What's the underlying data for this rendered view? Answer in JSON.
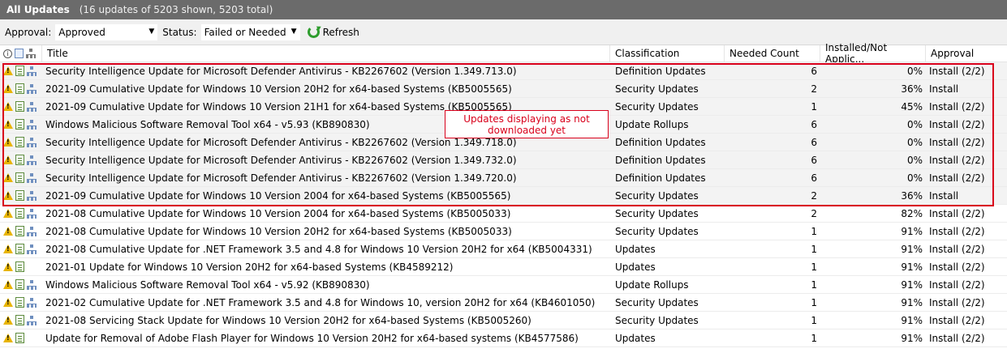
{
  "titlebar": {
    "title": "All Updates",
    "subtitle": "(16 updates of 5203 shown, 5203 total)"
  },
  "toolbar": {
    "approval_label": "Approval:",
    "approval_value": "Approved",
    "status_label": "Status:",
    "status_value": "Failed or Needed",
    "refresh_label": "Refresh"
  },
  "columns": {
    "title": "Title",
    "classification": "Classification",
    "needed": "Needed Count",
    "installed": "Installed/Not Applic...",
    "approval": "Approval"
  },
  "annotation": {
    "text": "Updates displaying as not downloaded yet",
    "color": "#d9001b"
  },
  "rows": [
    {
      "title": "Security Intelligence Update for Microsoft Defender Antivirus - KB2267602 (Version 1.349.713.0)",
      "classification": "Definition Updates",
      "needed": "6",
      "installed": "0%",
      "approval": "Install (2/2)",
      "icons": [
        "warning-icon",
        "update-doc-icon",
        "hierarchy-icon"
      ]
    },
    {
      "title": "2021-09 Cumulative Update for Windows 10 Version 20H2 for x64-based Systems (KB5005565)",
      "classification": "Security Updates",
      "needed": "2",
      "installed": "36%",
      "approval": "Install",
      "icons": [
        "warning-icon",
        "update-doc-icon",
        "hierarchy-icon"
      ]
    },
    {
      "title": "2021-09 Cumulative Update for Windows 10 Version 21H1 for x64-based Systems (KB5005565)",
      "classification": "Security Updates",
      "needed": "1",
      "installed": "45%",
      "approval": "Install (2/2)",
      "icons": [
        "warning-icon",
        "update-doc-icon",
        "hierarchy-icon"
      ]
    },
    {
      "title": "Windows Malicious Software Removal Tool x64 - v5.93 (KB890830)",
      "classification": "Update Rollups",
      "needed": "6",
      "installed": "0%",
      "approval": "Install (2/2)",
      "icons": [
        "warning-icon",
        "update-doc-icon",
        "hierarchy-icon"
      ]
    },
    {
      "title": "Security Intelligence Update for Microsoft Defender Antivirus - KB2267602 (Version 1.349.718.0)",
      "classification": "Definition Updates",
      "needed": "6",
      "installed": "0%",
      "approval": "Install (2/2)",
      "icons": [
        "warning-icon",
        "update-doc-icon",
        "hierarchy-icon"
      ]
    },
    {
      "title": "Security Intelligence Update for Microsoft Defender Antivirus - KB2267602 (Version 1.349.732.0)",
      "classification": "Definition Updates",
      "needed": "6",
      "installed": "0%",
      "approval": "Install (2/2)",
      "icons": [
        "warning-icon",
        "update-doc-icon",
        "hierarchy-icon"
      ]
    },
    {
      "title": "Security Intelligence Update for Microsoft Defender Antivirus - KB2267602 (Version 1.349.720.0)",
      "classification": "Definition Updates",
      "needed": "6",
      "installed": "0%",
      "approval": "Install (2/2)",
      "icons": [
        "warning-icon",
        "update-doc-icon",
        "hierarchy-icon"
      ]
    },
    {
      "title": "2021-09 Cumulative Update for Windows 10 Version 2004 for x64-based Systems (KB5005565)",
      "classification": "Security Updates",
      "needed": "2",
      "installed": "36%",
      "approval": "Install",
      "icons": [
        "warning-icon",
        "update-doc-icon",
        "hierarchy-icon"
      ]
    },
    {
      "title": "2021-08 Cumulative Update for Windows 10 Version 2004 for x64-based Systems (KB5005033)",
      "classification": "Security Updates",
      "needed": "2",
      "installed": "82%",
      "approval": "Install (2/2)",
      "icons": [
        "warning-icon",
        "update-doc-icon",
        "hierarchy-icon"
      ]
    },
    {
      "title": "2021-08 Cumulative Update for Windows 10 Version 20H2 for x64-based Systems (KB5005033)",
      "classification": "Security Updates",
      "needed": "1",
      "installed": "91%",
      "approval": "Install (2/2)",
      "icons": [
        "warning-icon",
        "update-doc-icon",
        "hierarchy-icon"
      ]
    },
    {
      "title": "2021-08 Cumulative Update for .NET Framework 3.5 and 4.8 for Windows 10 Version 20H2 for x64 (KB5004331)",
      "classification": "Updates",
      "needed": "1",
      "installed": "91%",
      "approval": "Install (2/2)",
      "icons": [
        "warning-icon",
        "update-doc-icon",
        "hierarchy-icon"
      ]
    },
    {
      "title": "2021-01 Update for Windows 10 Version 20H2 for x64-based Systems (KB4589212)",
      "classification": "Updates",
      "needed": "1",
      "installed": "91%",
      "approval": "Install (2/2)",
      "icons": [
        "warning-icon",
        "update-doc-icon"
      ]
    },
    {
      "title": "Windows Malicious Software Removal Tool x64 - v5.92 (KB890830)",
      "classification": "Update Rollups",
      "needed": "1",
      "installed": "91%",
      "approval": "Install (2/2)",
      "icons": [
        "warning-icon",
        "update-doc-icon",
        "hierarchy-icon"
      ]
    },
    {
      "title": "2021-02 Cumulative Update for .NET Framework 3.5 and 4.8 for Windows 10, version 20H2 for x64 (KB4601050)",
      "classification": "Security Updates",
      "needed": "1",
      "installed": "91%",
      "approval": "Install (2/2)",
      "icons": [
        "warning-icon",
        "update-doc-icon",
        "hierarchy-icon"
      ]
    },
    {
      "title": "2021-08 Servicing Stack Update for Windows 10 Version 20H2 for x64-based Systems (KB5005260)",
      "classification": "Security Updates",
      "needed": "1",
      "installed": "91%",
      "approval": "Install (2/2)",
      "icons": [
        "warning-icon",
        "update-doc-icon",
        "hierarchy-icon"
      ]
    },
    {
      "title": "Update for Removal of Adobe Flash Player for Windows 10 Version 20H2 for x64-based systems (KB4577586)",
      "classification": "Updates",
      "needed": "1",
      "installed": "91%",
      "approval": "Install (2/2)",
      "icons": [
        "warning-icon",
        "update-doc-icon"
      ]
    }
  ]
}
